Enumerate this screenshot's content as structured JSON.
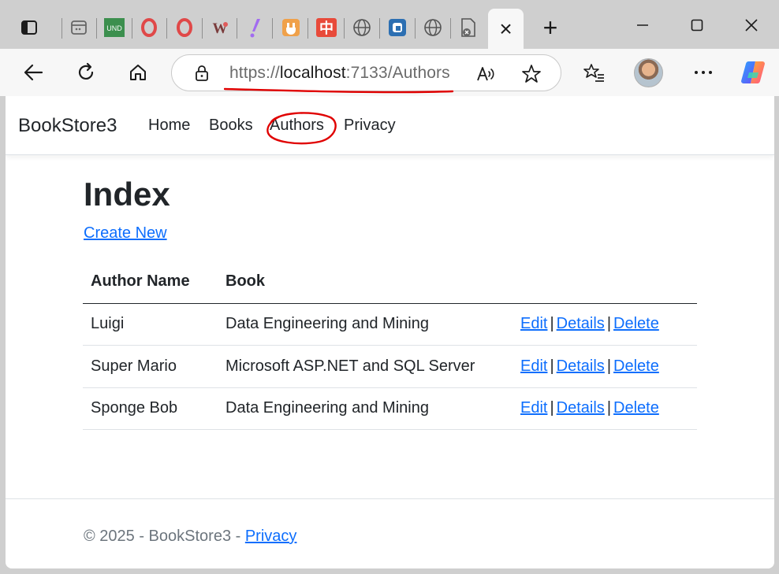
{
  "browser": {
    "url_scheme": "https://",
    "url_host": "localhost",
    "url_rest": ":7133/Authors",
    "tab_close_glyph": "×",
    "new_tab_glyph": "+",
    "tab_icons": [
      "sidebar-icon",
      "app-icon",
      "und-icon",
      "opera-icon",
      "opera-icon",
      "wiki-icon",
      "exclaim-icon",
      "plug-icon",
      "chinese-icon",
      "globe-icon",
      "app-blue-icon",
      "globe-icon",
      "doc-icon"
    ],
    "und_label": "UND",
    "wiki_label": "W",
    "chinese_label": "中"
  },
  "nav": {
    "brand": "BookStore3",
    "links": [
      "Home",
      "Books",
      "Authors",
      "Privacy"
    ]
  },
  "page": {
    "title": "Index",
    "create_link": "Create New"
  },
  "table": {
    "headers": [
      "Author Name",
      "Book"
    ],
    "rows": [
      {
        "author": "Luigi",
        "book": "Data Engineering and Mining"
      },
      {
        "author": "Super Mario",
        "book": "Microsoft ASP.NET and SQL Server"
      },
      {
        "author": "Sponge Bob",
        "book": "Data Engineering and Mining"
      }
    ],
    "actions": [
      "Edit",
      "Details",
      "Delete"
    ],
    "separator": "|"
  },
  "footer": {
    "text": "© 2025 - BookStore3 - ",
    "link": "Privacy"
  },
  "colors": {
    "link": "#0d6efd",
    "annotation_red": "#e00000"
  }
}
